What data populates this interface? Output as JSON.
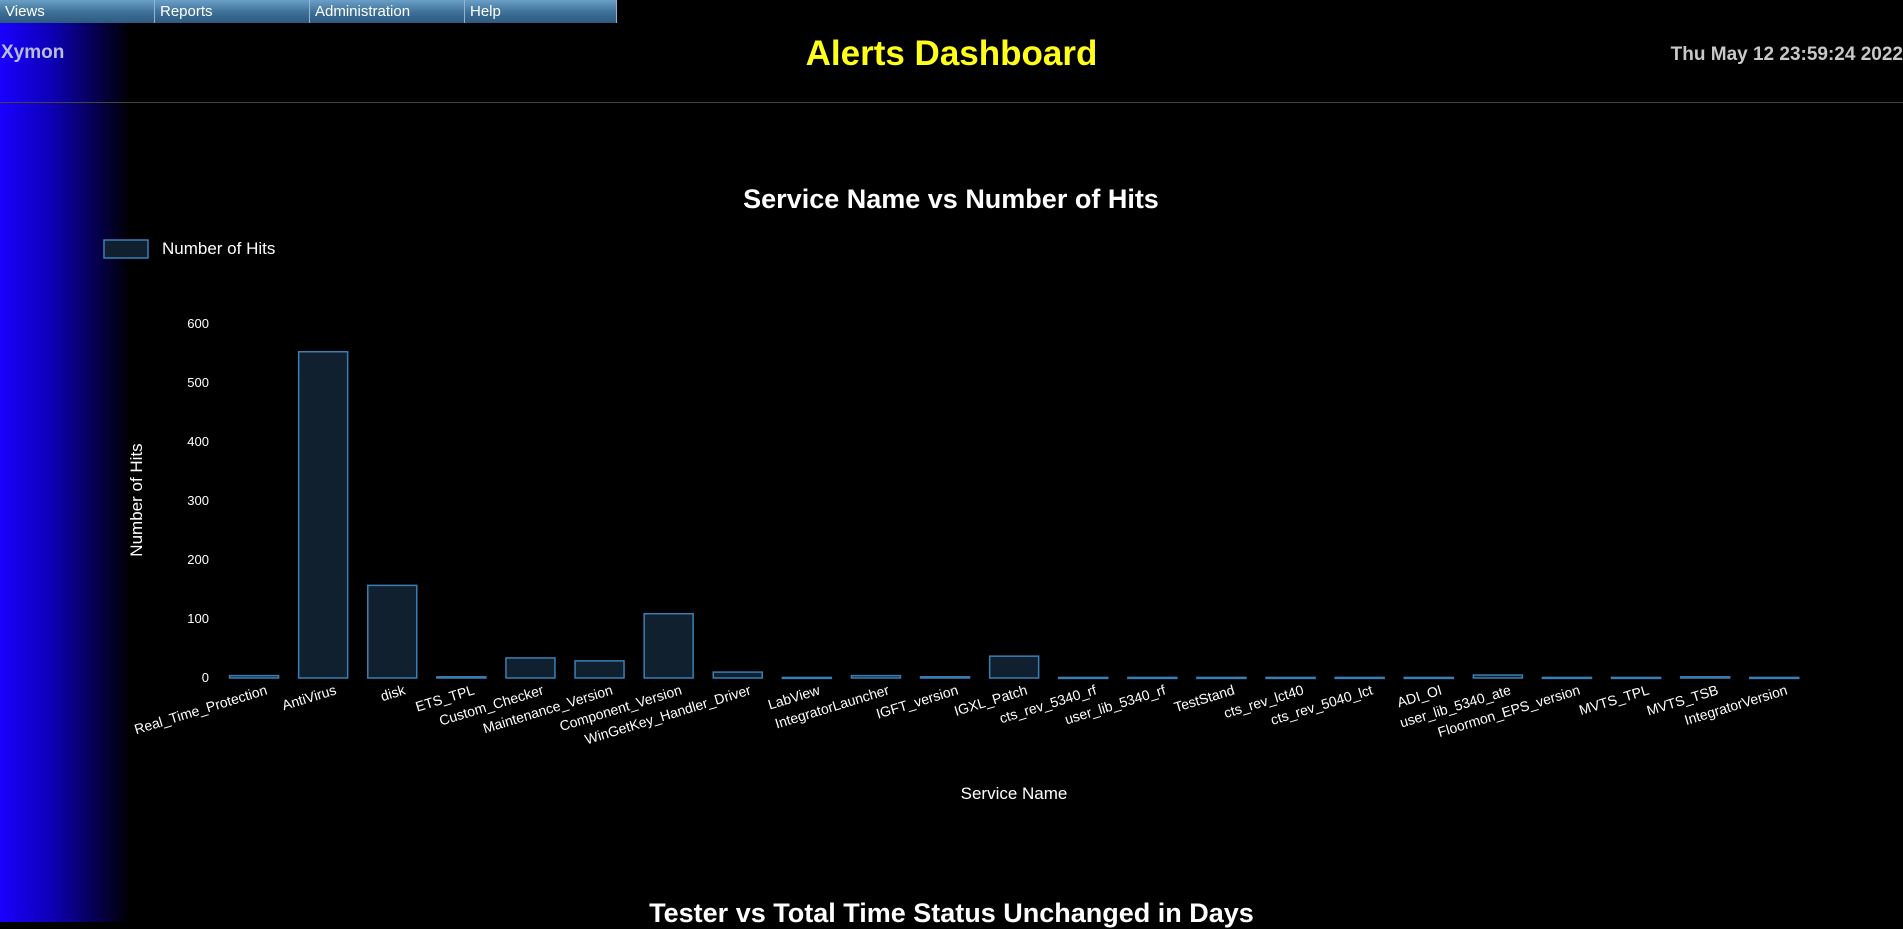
{
  "menu": {
    "items": [
      {
        "label": "Views",
        "width": 155
      },
      {
        "label": "Reports",
        "width": 155
      },
      {
        "label": "Administration",
        "width": 155
      },
      {
        "label": "Help",
        "width": 152
      }
    ]
  },
  "header": {
    "brand": "Xymon",
    "title": "Alerts Dashboard",
    "datetime": "Thu May 12 23:59:24 2022"
  },
  "colors": {
    "bar_fill": "#10202e",
    "bar_stroke": "#3a7fb4",
    "title_yellow": "#ffff1a"
  },
  "chart_data": [
    {
      "type": "bar",
      "title": "Service Name vs Number of Hits",
      "xlabel": "Service Name",
      "ylabel": "Number of Hits",
      "ylim": [
        0,
        600
      ],
      "yticks": [
        0,
        100,
        200,
        300,
        400,
        500,
        600
      ],
      "grid": false,
      "legend_position": "top-left",
      "categories": [
        "Real_Time_Protection",
        "AntiVirus",
        "disk",
        "ETS_TPL",
        "Custom_Checker",
        "Maintenance_Version",
        "Component_Version",
        "WinGetKey_Handler_Driver",
        "LabView",
        "IntegratorLauncher",
        "IGFT_version",
        "IGXL_Patch",
        "cts_rev_5340_rf",
        "user_lib_5340_rf",
        "TestStand",
        "cts_rev_lct40",
        "cts_rev_5040_lct",
        "ADI_OI",
        "user_lib_5340_ate",
        "Floormon_EPS_version",
        "MVTS_TPL",
        "MVTS_TSB",
        "IntegratorVersion"
      ],
      "series": [
        {
          "name": "Number of Hits",
          "values": [
            4,
            553,
            157,
            2,
            34,
            29,
            109,
            10,
            1,
            4,
            2,
            37,
            1,
            1,
            1,
            1,
            1,
            1,
            5,
            1,
            1,
            2,
            1
          ]
        }
      ]
    },
    {
      "type": "bar",
      "title": "Tester vs Total Time Status Unchanged in Days"
    }
  ]
}
